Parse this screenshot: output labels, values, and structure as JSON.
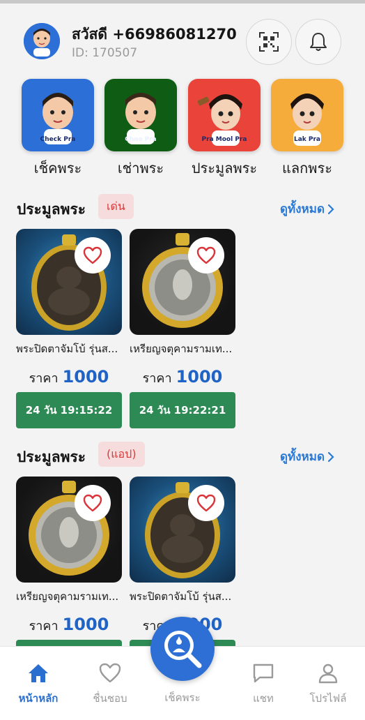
{
  "header": {
    "greeting": "สวัสดี +66986081270",
    "user_id": "ID: 170507",
    "avatar_text": "Check Pra",
    "qr_icon": "qr-code-icon",
    "bell_icon": "bell-icon"
  },
  "categories": [
    {
      "label": "เช็คพระ",
      "tile_text": "Check Pra",
      "color": "#2c6fd6"
    },
    {
      "label": "เช่าพระ",
      "tile_text": "Chao Pra",
      "color": "#0f5d14"
    },
    {
      "label": "ประมูลพระ",
      "tile_text": "Pra Mool Pra",
      "color": "#e9433a"
    },
    {
      "label": "แลกพระ",
      "tile_text": "Lak Pra",
      "color": "#f6ac3a"
    }
  ],
  "sections": [
    {
      "title": "ประมูลพระ",
      "badge": "เด่น",
      "see_all": "ดูทั้งหมด",
      "items": [
        {
          "title": "พระปิดตาจัมโบ้ รุ่นส...",
          "price_label": "ราคา",
          "price": "1000",
          "timer": "24 วัน 19:15:22"
        },
        {
          "title": "เหรียญจตุคามรามเท...",
          "price_label": "ราคา",
          "price": "1000",
          "timer": "24 วัน 19:22:21"
        }
      ]
    },
    {
      "title": "ประมูลพระ",
      "badge": "(แอป)",
      "see_all": "ดูทั้งหมด",
      "items": [
        {
          "title": "เหรียญจตุคามรามเท...",
          "price_label": "ราคา",
          "price": "1000"
        },
        {
          "title": "พระปิดตาจัมโบ้ รุ่นส...",
          "price_label": "ราคา",
          "price": "1000"
        }
      ]
    }
  ],
  "bottom_nav": {
    "home": "หน้าหลัก",
    "favorites": "ชื่นชอบ",
    "check": "เช็คพระ",
    "chat": "แชท",
    "profile": "โปรไฟล์"
  },
  "colors": {
    "accent": "#2a6fd0",
    "timer_bg": "#2e8a55",
    "badge_bg": "#f6dcdc",
    "badge_text": "#d63a3a",
    "price": "#1f63c6"
  }
}
